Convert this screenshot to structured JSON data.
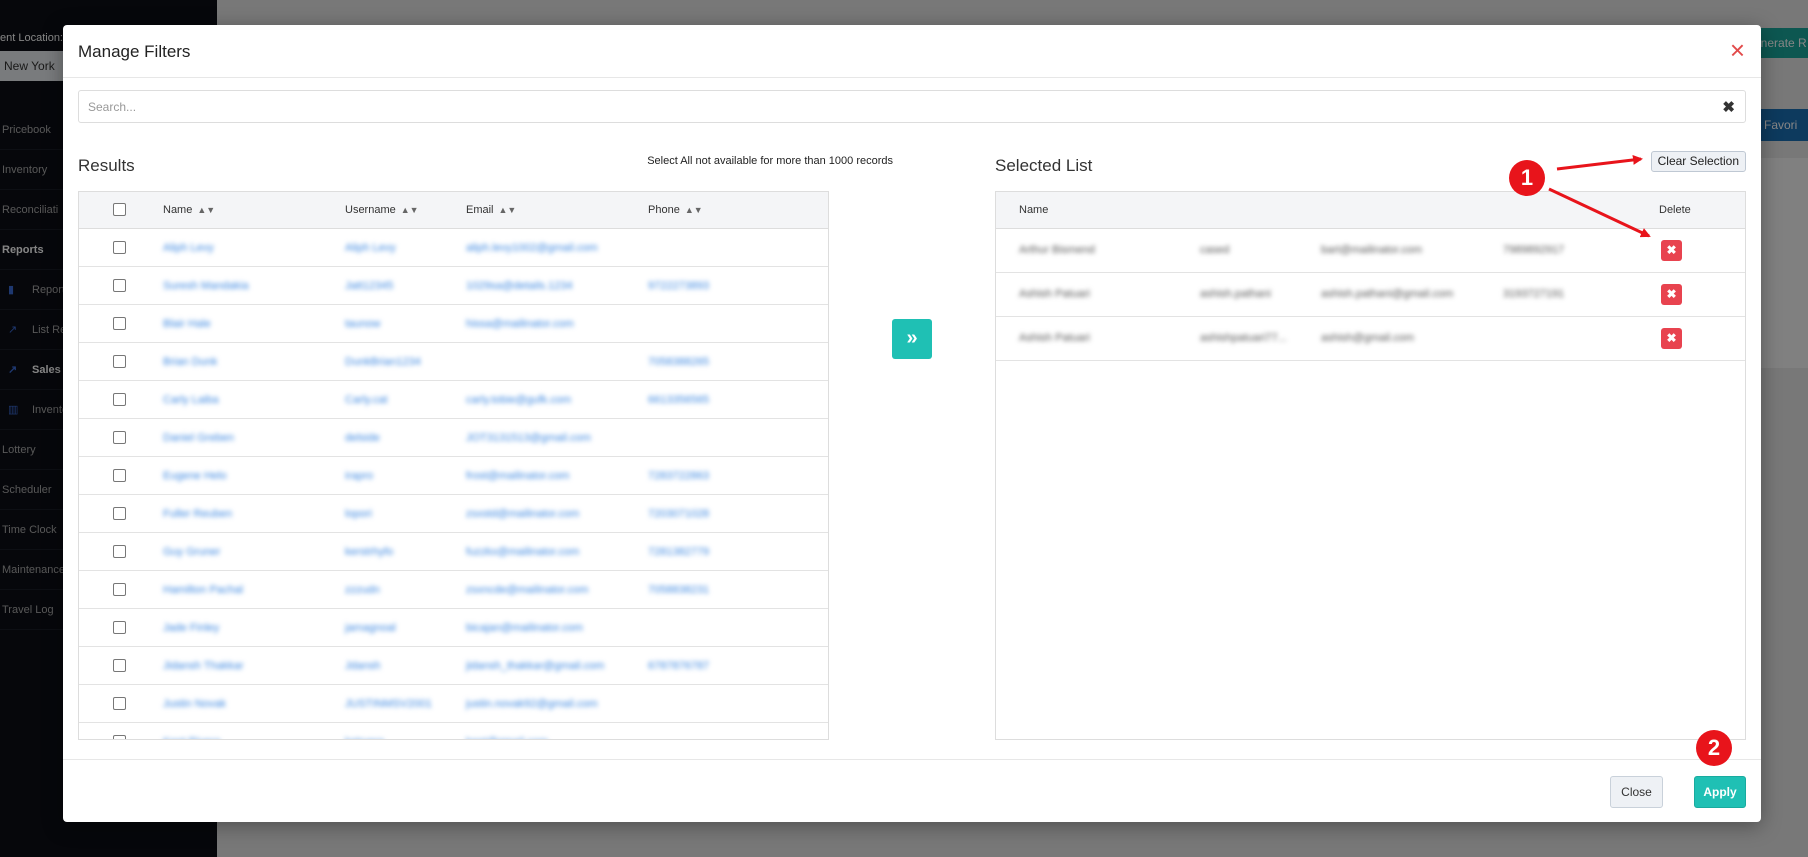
{
  "background": {
    "location_label": "ent Location:",
    "location_value": "New York",
    "nav": [
      {
        "label": "Pricebook",
        "active": false,
        "sub": false
      },
      {
        "label": "Inventory",
        "active": false,
        "sub": false
      },
      {
        "label": "Reconciliati",
        "active": false,
        "sub": false
      },
      {
        "label": "Reports",
        "active": true,
        "sub": false
      },
      {
        "label": "Report",
        "active": false,
        "sub": true,
        "icon": "bookmark-icon"
      },
      {
        "label": "List Re",
        "active": false,
        "sub": true,
        "icon": "line-chart-icon"
      },
      {
        "label": "Sales R",
        "active": true,
        "sub": true,
        "icon": "line-chart-icon"
      },
      {
        "label": "Invento",
        "active": false,
        "sub": true,
        "icon": "bar-chart-icon"
      },
      {
        "label": "Lottery",
        "active": false,
        "sub": false
      },
      {
        "label": "Scheduler",
        "active": false,
        "sub": false
      },
      {
        "label": "Time Clock",
        "active": false,
        "sub": false
      },
      {
        "label": "Maintenance",
        "active": false,
        "sub": false
      },
      {
        "label": "Travel Log",
        "active": false,
        "sub": false
      }
    ],
    "generate_button": "enerate R",
    "favorite_button": "e Favori"
  },
  "modal": {
    "title": "Manage Filters",
    "close_icon": "×",
    "search": {
      "placeholder": "Search...",
      "value": "",
      "clear_icon": "✖"
    },
    "results": {
      "title": "Results",
      "note": "Select All not available for more than 1000 records",
      "columns": [
        "Name",
        "Username",
        "Email",
        "Phone"
      ],
      "rows": [
        {
          "name": "Aliph Levy",
          "username": "Aliph Levy",
          "email": "aliph.levy1002@gmail.com",
          "phone": ""
        },
        {
          "name": "Suresh Mandakia",
          "username": "Jatt12345",
          "email": "1029sa@details.1234",
          "phone": "9722273893"
        },
        {
          "name": "Blair Hale",
          "username": "taunow",
          "email": "hissa@mailinator.com",
          "phone": ""
        },
        {
          "name": "Brian Dunk",
          "username": "DunkBrian1234",
          "email": "",
          "phone": "7058388265"
        },
        {
          "name": "Carly Laiba",
          "username": "Carly.cat",
          "email": "carly.tobie@gufk.com",
          "phone": "6613356565"
        },
        {
          "name": "Daniel Greben",
          "username": "delside",
          "email": "JOT3131513@gmail.com",
          "phone": ""
        },
        {
          "name": "Eugene Helo",
          "username": "irapro",
          "email": "frost@mailinator.com",
          "phone": "7283722863"
        },
        {
          "name": "Fuller Reuben",
          "username": "lopori",
          "email": "zsxstd@mailinator.com",
          "phone": "7203071028"
        },
        {
          "name": "Guy Gruner",
          "username": "kerstrhyfo",
          "email": "fuzzkx@mailinator.com",
          "phone": "7281382779"
        },
        {
          "name": "Hamilton Pachal",
          "username": "zzzudn",
          "email": "zsxncde@mailinator.com",
          "phone": "7058838231"
        },
        {
          "name": "Jade Finley",
          "username": "jamagnoal",
          "email": "bicajan@mailinator.com",
          "phone": ""
        },
        {
          "name": "Jidansh Thakkar",
          "username": "Jdansh",
          "email": "jidansh_thakkar@gmail.com",
          "phone": "6787876787"
        },
        {
          "name": "Justin Novak",
          "username": "JUSTINMSV2001",
          "email": "justin.novak92@gmail.com",
          "phone": ""
        },
        {
          "name": "Kent Rivera",
          "username": "kstrvera",
          "email": "kent@gmail.com",
          "phone": ""
        }
      ]
    },
    "transfer_icon": "»",
    "selected": {
      "title": "Selected List",
      "clear_label": "Clear Selection",
      "columns": [
        "Name",
        "Delete"
      ],
      "rows": [
        {
          "name": "Arthur Bismend",
          "username": "cased",
          "email": "bart@mailinator.com",
          "phone": "7989892917"
        },
        {
          "name": "Ashish Patuari",
          "username": "ashish.pathani",
          "email": "ashish.pathani@gmail.com",
          "phone": "3193727191"
        },
        {
          "name": "Ashish Patuari",
          "username": "ashishpatuari77...",
          "email": "ashish@gmail.com",
          "phone": ""
        }
      ],
      "delete_icon": "✖"
    },
    "footer": {
      "close_label": "Close",
      "apply_label": "Apply"
    }
  },
  "annotations": {
    "badge_1": "1",
    "badge_2": "2",
    "color": "#e8141b"
  }
}
